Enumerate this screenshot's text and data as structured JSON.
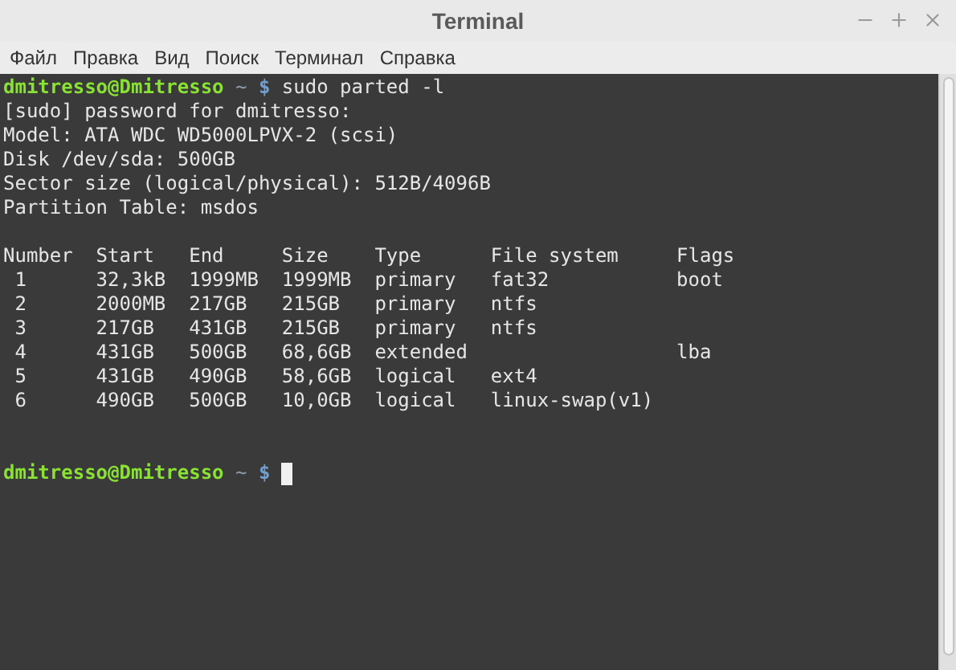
{
  "window": {
    "title": "Terminal"
  },
  "menu": [
    "Файл",
    "Правка",
    "Вид",
    "Поиск",
    "Терминал",
    "Справка"
  ],
  "terminal": {
    "command_prompt": {
      "user_host": "dmitresso@Dmitresso",
      "path": "~",
      "symbol": "$",
      "command": "sudo parted -l"
    },
    "output_lines": [
      "[sudo] password for dmitresso:",
      "Model: ATA WDC WD5000LPVX-2 (scsi)",
      "Disk /dev/sda: 500GB",
      "Sector size (logical/physical): 512B/4096B",
      "Partition Table: msdos"
    ],
    "table": {
      "columns": [
        "Number",
        "Start",
        "End",
        "Size",
        "Type",
        "File system",
        "Flags"
      ],
      "rows": [
        [
          "1",
          "32,3kB",
          "1999MB",
          "1999MB",
          "primary",
          "fat32",
          "boot"
        ],
        [
          "2",
          "2000MB",
          "217GB",
          "215GB",
          "primary",
          "ntfs",
          ""
        ],
        [
          "3",
          "217GB",
          "431GB",
          "215GB",
          "primary",
          "ntfs",
          ""
        ],
        [
          "4",
          "431GB",
          "500GB",
          "68,6GB",
          "extended",
          "",
          "lba"
        ],
        [
          "5",
          "431GB",
          "490GB",
          "58,6GB",
          "logical",
          "ext4",
          ""
        ],
        [
          "6",
          "490GB",
          "500GB",
          "10,0GB",
          "logical",
          "linux-swap(v1)",
          ""
        ]
      ]
    },
    "idle_prompt": {
      "user_host": "dmitresso@Dmitresso",
      "path": "~",
      "symbol": "$"
    }
  }
}
